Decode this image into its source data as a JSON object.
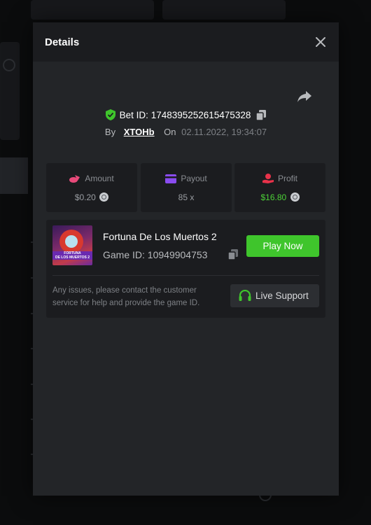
{
  "modal": {
    "title": "Details",
    "bet_id_label": "Bet ID:",
    "bet_id": "1748395252615475328",
    "by_label": "By",
    "username": "XTOHb",
    "on_label": "On",
    "date": "02.11.2022, 19:34:07"
  },
  "stats": [
    {
      "label": "Amount",
      "value": "$0.20",
      "icon": "coins-icon",
      "icon_color": "#e84a7a"
    },
    {
      "label": "Payout",
      "value": "85 x",
      "icon": "card-icon",
      "icon_color": "#8a4cf0"
    },
    {
      "label": "Profit",
      "value": "$16.80",
      "icon": "hand-coin-icon",
      "icon_color": "#e8324a"
    }
  ],
  "game": {
    "name": "Fortuna De Los Muertos 2",
    "id_label": "Game ID:",
    "id": "10949904753",
    "play_label": "Play Now",
    "thumb_text": "FORTUNA DE LOS MUERTOS 2"
  },
  "support": {
    "text": "Any issues, please contact the customer service for help and provide the game ID.",
    "button_label": "Live Support"
  },
  "colors": {
    "accent_green": "#3fc52c",
    "profit_green": "#4cd137",
    "modal_bg": "#232528"
  }
}
